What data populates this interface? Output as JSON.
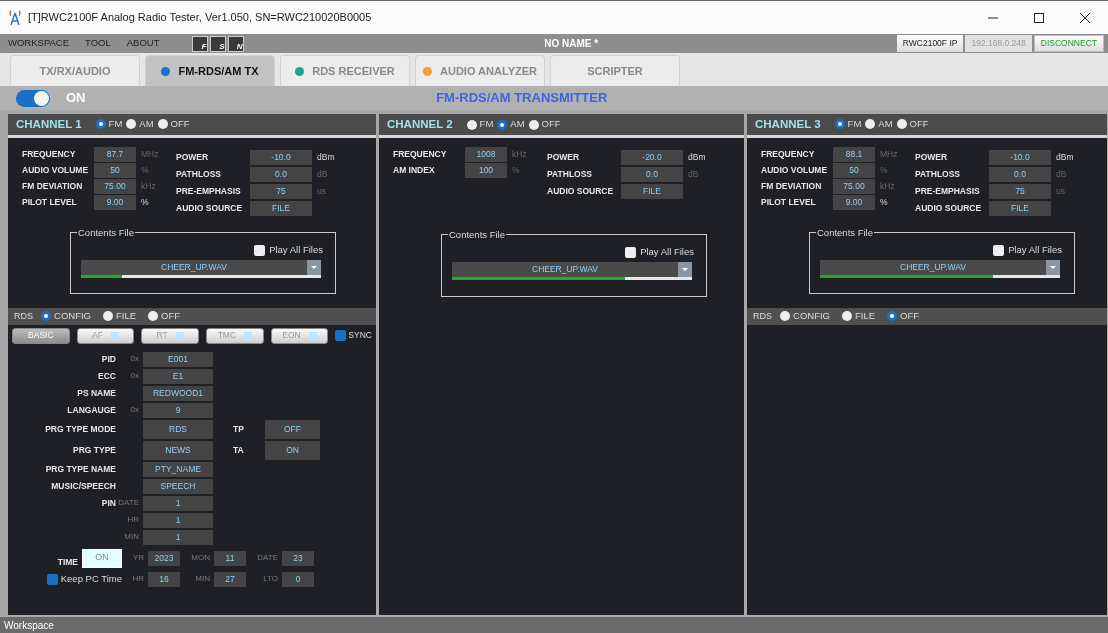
{
  "window": {
    "title": "[T]RWC2100F Analog Radio Tester, Ver1.050, SN=RWC210020B0005"
  },
  "menu": [
    "WORKSPACE",
    "TOOL",
    "ABOUT"
  ],
  "toolbar": [
    {
      "letter": "F"
    },
    {
      "letter": "S"
    },
    {
      "letter": "N"
    }
  ],
  "document_name": "NO NAME *",
  "connection": {
    "label": "RWC2100F IP",
    "ip": "192.168.0.248",
    "button": "DISCONNECT"
  },
  "tabs": [
    {
      "label": "TX/RX/AUDIO",
      "selected": false
    },
    {
      "label": "FM-RDS/AM TX",
      "selected": true,
      "color": "#1f6fd1"
    },
    {
      "label": "RDS RECEIVER",
      "selected": false,
      "color": "#1aa88a"
    },
    {
      "label": "AUDIO ANALYZER",
      "selected": false,
      "color": "#f0a030"
    },
    {
      "label": "SCRIPTER",
      "selected": false
    }
  ],
  "power": {
    "on": true,
    "label": "ON"
  },
  "heading": "FM-RDS/AM TRANSMITTER",
  "channels": [
    {
      "title": "CHANNEL 1",
      "modes": [
        {
          "label": "FM",
          "selected": true
        },
        {
          "label": "AM",
          "selected": false
        },
        {
          "label": "OFF",
          "selected": false
        }
      ],
      "left": [
        {
          "label": "FREQUENCY",
          "value": "87.7",
          "unit": "MHz",
          "unit_dim": true
        },
        {
          "label": "AUDIO VOLUME",
          "value": "50",
          "unit": "%",
          "unit_dim": true
        },
        {
          "label": "FM DEVIATION",
          "value": "75.00",
          "unit": "kHz",
          "unit_dim": true
        },
        {
          "label": "PILOT LEVEL",
          "value": "9.00",
          "unit": "%",
          "unit_dim": false
        }
      ],
      "right": [
        {
          "label": "POWER",
          "value": "-10.0",
          "unit": "dBm",
          "unit_dim": false
        },
        {
          "label": "PATHLOSS",
          "value": "0.0",
          "unit": "dB",
          "unit_dim": true
        },
        {
          "label": "PRE-EMPHASIS",
          "value": "75",
          "unit": "us",
          "unit_dim": true
        },
        {
          "label": "AUDIO SOURCE",
          "value": "FILE"
        }
      ],
      "contents": {
        "legend": "Contents File",
        "play_all": {
          "label": "Play All Files",
          "checked": false
        },
        "file": "CHEER_UP.WAV",
        "level": 0.17
      },
      "rds": {
        "label": "RDS",
        "modes": [
          {
            "label": "CONFIG",
            "selected": true
          },
          {
            "label": "FILE",
            "selected": false
          },
          {
            "label": "OFF",
            "selected": false
          }
        ],
        "subtabs": [
          {
            "label": "BASIC",
            "selected": true,
            "indicator": false
          },
          {
            "label": "AF",
            "selected": false,
            "indicator": true
          },
          {
            "label": "RT",
            "selected": false,
            "indicator": true
          },
          {
            "label": "TMC",
            "selected": false,
            "indicator": true
          },
          {
            "label": "EON",
            "selected": false,
            "indicator": true
          }
        ],
        "sync": {
          "label": "SYNC",
          "checked": true
        },
        "fields": [
          {
            "label": "PID",
            "prefix": "0x",
            "value": "E001"
          },
          {
            "label": "ECC",
            "prefix": "0x",
            "value": "E1"
          },
          {
            "label": "PS NAME",
            "value": "REDWOOD1"
          },
          {
            "label": "LANGAUGE",
            "prefix": "0x",
            "value": "9"
          },
          {
            "label": "PRG TYPE MODE",
            "value": "RDS",
            "side": {
              "label": "TP",
              "value": "OFF"
            }
          },
          {
            "label": "PRG TYPE",
            "value": "NEWS",
            "side": {
              "label": "TA",
              "value": "ON"
            }
          },
          {
            "label": "PRG TYPE NAME",
            "value": "PTY_NAME"
          },
          {
            "label": "MUSIC/SPEECH",
            "value": "SPEECH"
          },
          {
            "label": "PIN",
            "prefix": "DATE",
            "value": "1"
          },
          {
            "prefix": "HR",
            "value": "1"
          },
          {
            "prefix": "MIN",
            "value": "1"
          }
        ],
        "time": {
          "label": "TIME",
          "button": "ON",
          "keep_pc_time": {
            "label": "Keep PC Time",
            "checked": true
          },
          "rows": [
            [
              {
                "label": "YR",
                "value": "2023"
              },
              {
                "label": "MON",
                "value": "11"
              },
              {
                "label": "DATE",
                "value": "23"
              }
            ],
            [
              {
                "label": "HR",
                "value": "16"
              },
              {
                "label": "MIN",
                "value": "27"
              },
              {
                "label": "LTO",
                "value": "0"
              }
            ]
          ]
        }
      }
    },
    {
      "title": "CHANNEL 2",
      "modes": [
        {
          "label": "FM",
          "selected": false
        },
        {
          "label": "AM",
          "selected": true
        },
        {
          "label": "OFF",
          "selected": false
        }
      ],
      "left": [
        {
          "label": "FREQUENCY",
          "value": "1008",
          "unit": "kHz",
          "unit_dim": true
        },
        {
          "label": "AM INDEX",
          "value": "100",
          "unit": "%",
          "unit_dim": true
        }
      ],
      "right": [
        {
          "label": "POWER",
          "value": "-20.0",
          "unit": "dBm",
          "unit_dim": false
        },
        {
          "label": "PATHLOSS",
          "value": "0.0",
          "unit": "dB",
          "unit_dim": true
        },
        {
          "label": "AUDIO SOURCE",
          "value": "FILE"
        }
      ],
      "contents": {
        "legend": "Contents File",
        "play_all": {
          "label": "Play All Files",
          "checked": false
        },
        "file": "CHEER_UP.WAV",
        "level": 0.72
      }
    },
    {
      "title": "CHANNEL 3",
      "modes": [
        {
          "label": "FM",
          "selected": true
        },
        {
          "label": "AM",
          "selected": false
        },
        {
          "label": "OFF",
          "selected": false
        }
      ],
      "left": [
        {
          "label": "FREQUENCY",
          "value": "88.1",
          "unit": "MHz",
          "unit_dim": true
        },
        {
          "label": "AUDIO VOLUME",
          "value": "50",
          "unit": "%",
          "unit_dim": true
        },
        {
          "label": "FM DEVIATION",
          "value": "75.00",
          "unit": "kHz",
          "unit_dim": true
        },
        {
          "label": "PILOT LEVEL",
          "value": "9.00",
          "unit": "%",
          "unit_dim": false
        }
      ],
      "right": [
        {
          "label": "POWER",
          "value": "-10.0",
          "unit": "dBm",
          "unit_dim": false
        },
        {
          "label": "PATHLOSS",
          "value": "0.0",
          "unit": "dB",
          "unit_dim": true
        },
        {
          "label": "PRE-EMPHASIS",
          "value": "75",
          "unit": "us",
          "unit_dim": true
        },
        {
          "label": "AUDIO SOURCE",
          "value": "FILE"
        }
      ],
      "contents": {
        "legend": "Contents File",
        "play_all": {
          "label": "Play All Files",
          "checked": false
        },
        "file": "CHEER_UP.WAV",
        "level": 0.72
      },
      "rds": {
        "label": "RDS",
        "modes": [
          {
            "label": "CONFIG",
            "selected": false
          },
          {
            "label": "FILE",
            "selected": false
          },
          {
            "label": "OFF",
            "selected": true
          }
        ]
      }
    }
  ],
  "status_bar": "Workspace"
}
